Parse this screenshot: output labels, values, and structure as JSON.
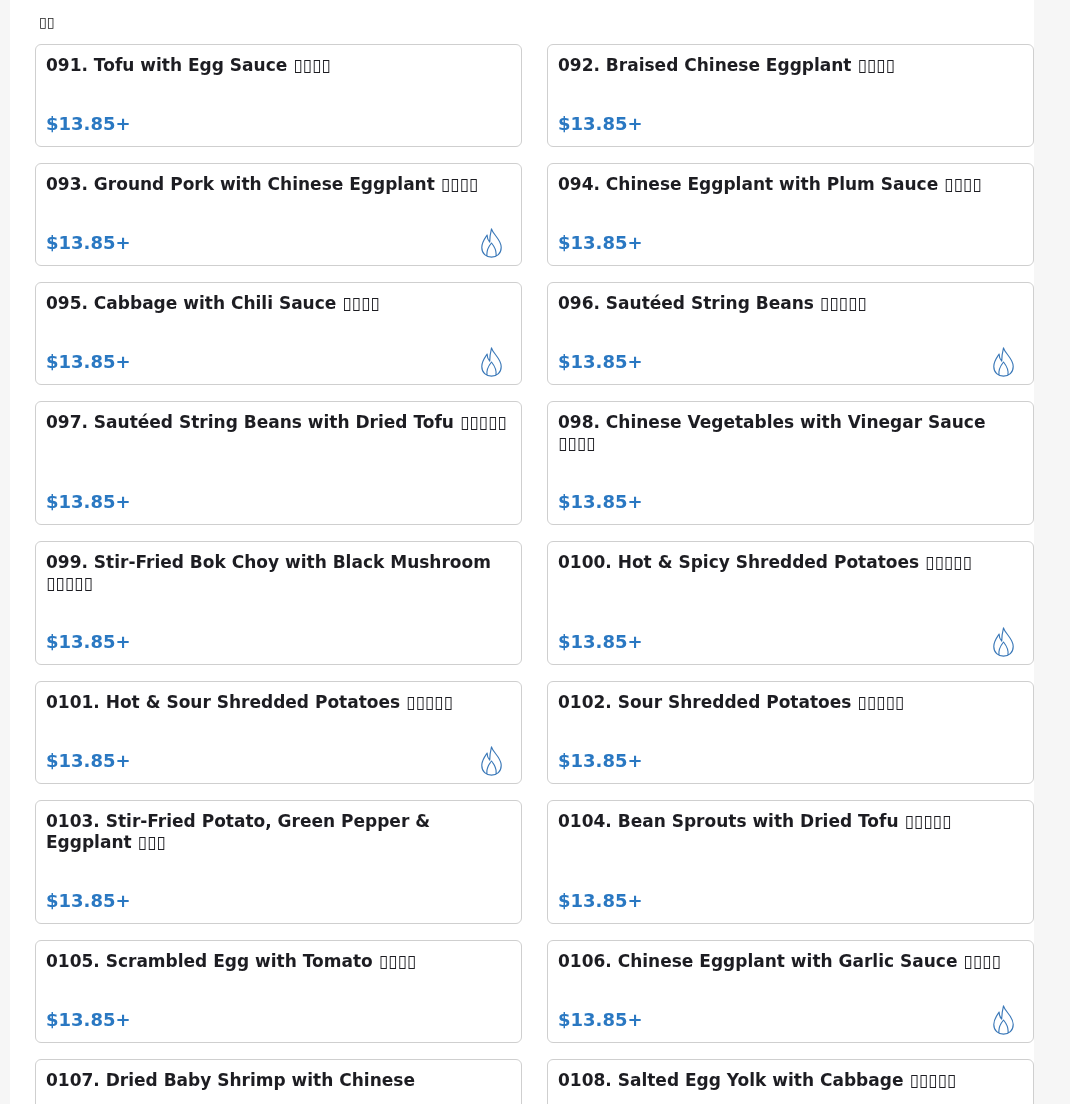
{
  "section_title": "▯▯",
  "items": [
    {
      "title": "091. Tofu with Egg Sauce ▯▯▯▯",
      "price": "$13.85+",
      "spicy": false
    },
    {
      "title": "092. Braised Chinese Eggplant ▯▯▯▯",
      "price": "$13.85+",
      "spicy": false
    },
    {
      "title": "093. Ground Pork with Chinese Eggplant ▯▯▯▯",
      "price": "$13.85+",
      "spicy": true
    },
    {
      "title": "094. Chinese Eggplant with Plum Sauce ▯▯▯▯",
      "price": "$13.85+",
      "spicy": false
    },
    {
      "title": "095. Cabbage with Chili Sauce ▯▯▯▯",
      "price": "$13.85+",
      "spicy": true
    },
    {
      "title": "096. Sautéed String Beans ▯▯▯▯▯",
      "price": "$13.85+",
      "spicy": true
    },
    {
      "title": "097. Sautéed String Beans with Dried Tofu ▯▯▯▯▯",
      "price": "$13.85+",
      "spicy": false
    },
    {
      "title": "098. Chinese Vegetables with Vinegar Sauce ▯▯▯▯",
      "price": "$13.85+",
      "spicy": false
    },
    {
      "title": "099. Stir-Fried Bok Choy with Black Mushroom ▯▯▯▯▯",
      "price": "$13.85+",
      "spicy": false
    },
    {
      "title": "0100. Hot & Spicy Shredded Potatoes ▯▯▯▯▯",
      "price": "$13.85+",
      "spicy": true
    },
    {
      "title": "0101. Hot & Sour Shredded Potatoes ▯▯▯▯▯",
      "price": "$13.85+",
      "spicy": true
    },
    {
      "title": "0102. Sour Shredded Potatoes ▯▯▯▯▯",
      "price": "$13.85+",
      "spicy": false
    },
    {
      "title": "0103. Stir-Fried Potato, Green Pepper & Eggplant ▯▯▯",
      "price": "$13.85+",
      "spicy": false
    },
    {
      "title": "0104. Bean Sprouts with Dried Tofu ▯▯▯▯▯",
      "price": "$13.85+",
      "spicy": false
    },
    {
      "title": "0105. Scrambled Egg with Tomato ▯▯▯▯",
      "price": "$13.85+",
      "spicy": false
    },
    {
      "title": "0106. Chinese Eggplant with Garlic Sauce ▯▯▯▯",
      "price": "$13.85+",
      "spicy": true
    },
    {
      "title": "0107. Dried Baby Shrimp with Chinese",
      "spicy": false
    },
    {
      "title": "0108. Salted Egg Yolk with Cabbage ▯▯▯▯▯",
      "spicy": false
    }
  ]
}
